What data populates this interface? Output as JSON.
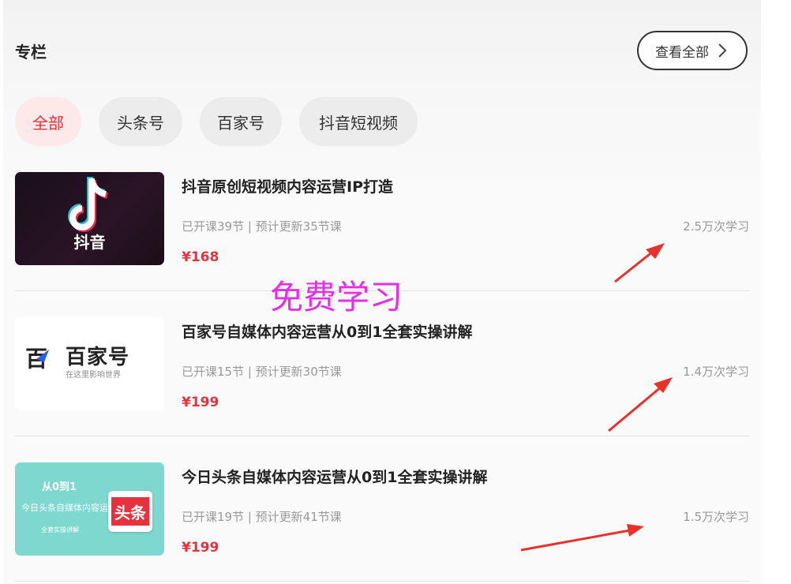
{
  "section": {
    "title": "专栏",
    "view_all_label": "查看全部"
  },
  "tabs": [
    {
      "label": "全部",
      "active": true
    },
    {
      "label": "头条号",
      "active": false
    },
    {
      "label": "百家号",
      "active": false
    },
    {
      "label": "抖音短视频",
      "active": false
    }
  ],
  "courses": [
    {
      "title": "抖音原创短视频内容运营IP打造",
      "meta": "已开课39节 | 预计更新35节课",
      "learners": "2.5万次学习",
      "price": "¥168",
      "thumb": {
        "logo_text": "抖音"
      }
    },
    {
      "title": "百家号自媒体内容运营从0到1全套实操讲解",
      "meta": "已开课15节 | 预计更新30节课",
      "learners": "1.4万次学习",
      "price": "¥199",
      "thumb": {
        "logo_char": "百",
        "brand": "百家号",
        "slogan": "在这里影响世界"
      }
    },
    {
      "title": "今日头条自媒体内容运营从0到1全套实操讲解",
      "meta": "已开课19节 | 预计更新41节课",
      "learners": "1.5万次学习",
      "price": "¥199",
      "thumb": {
        "badge": "从0到1",
        "headline": "今日头条自媒体内容运营",
        "sub": "全套实操讲解",
        "logo": "头条"
      }
    }
  ],
  "overlay_text": "免费学习",
  "colors": {
    "accent": "#e8313e",
    "overlay": "#e62ee6",
    "annotation_arrow": "#e8312c"
  }
}
